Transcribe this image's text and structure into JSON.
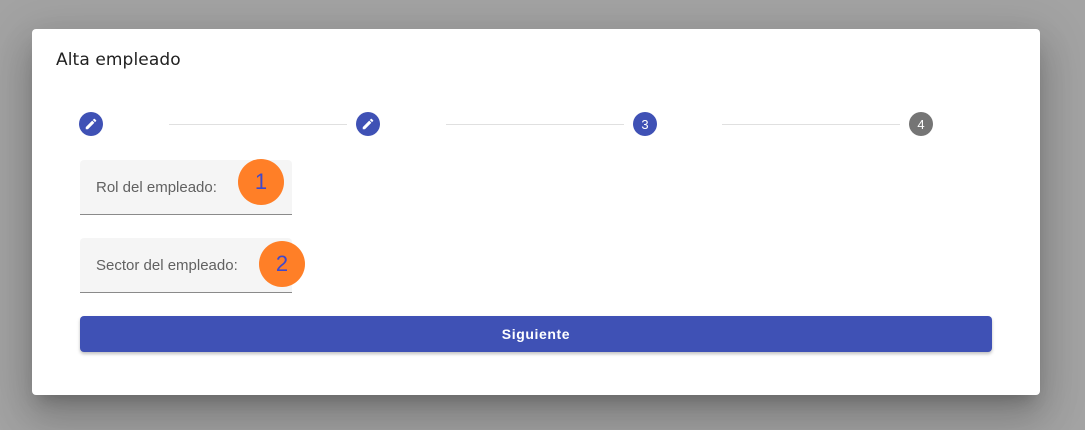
{
  "dialog": {
    "title": "Alta empleado"
  },
  "stepper": {
    "steps": [
      {
        "state": "edit",
        "label": "",
        "icon": "pencil-icon",
        "color": "#3f51b5"
      },
      {
        "state": "edit",
        "label": "",
        "icon": "pencil-icon",
        "color": "#3f51b5"
      },
      {
        "state": "current",
        "label": "3",
        "color": "#3f51b5"
      },
      {
        "state": "pending",
        "label": "4",
        "color": "#757575"
      }
    ]
  },
  "form": {
    "role_field": {
      "label": "Rol del empleado:",
      "value": ""
    },
    "sector_field": {
      "label": "Sector del empleado:",
      "value": ""
    }
  },
  "annotations": [
    {
      "label": "1",
      "color": "#ff7f27",
      "text_color": "#3f48cc"
    },
    {
      "label": "2",
      "color": "#ff7f27",
      "text_color": "#3f48cc"
    }
  ],
  "actions": {
    "next_label": "Siguiente",
    "color": "#3f51b5"
  }
}
